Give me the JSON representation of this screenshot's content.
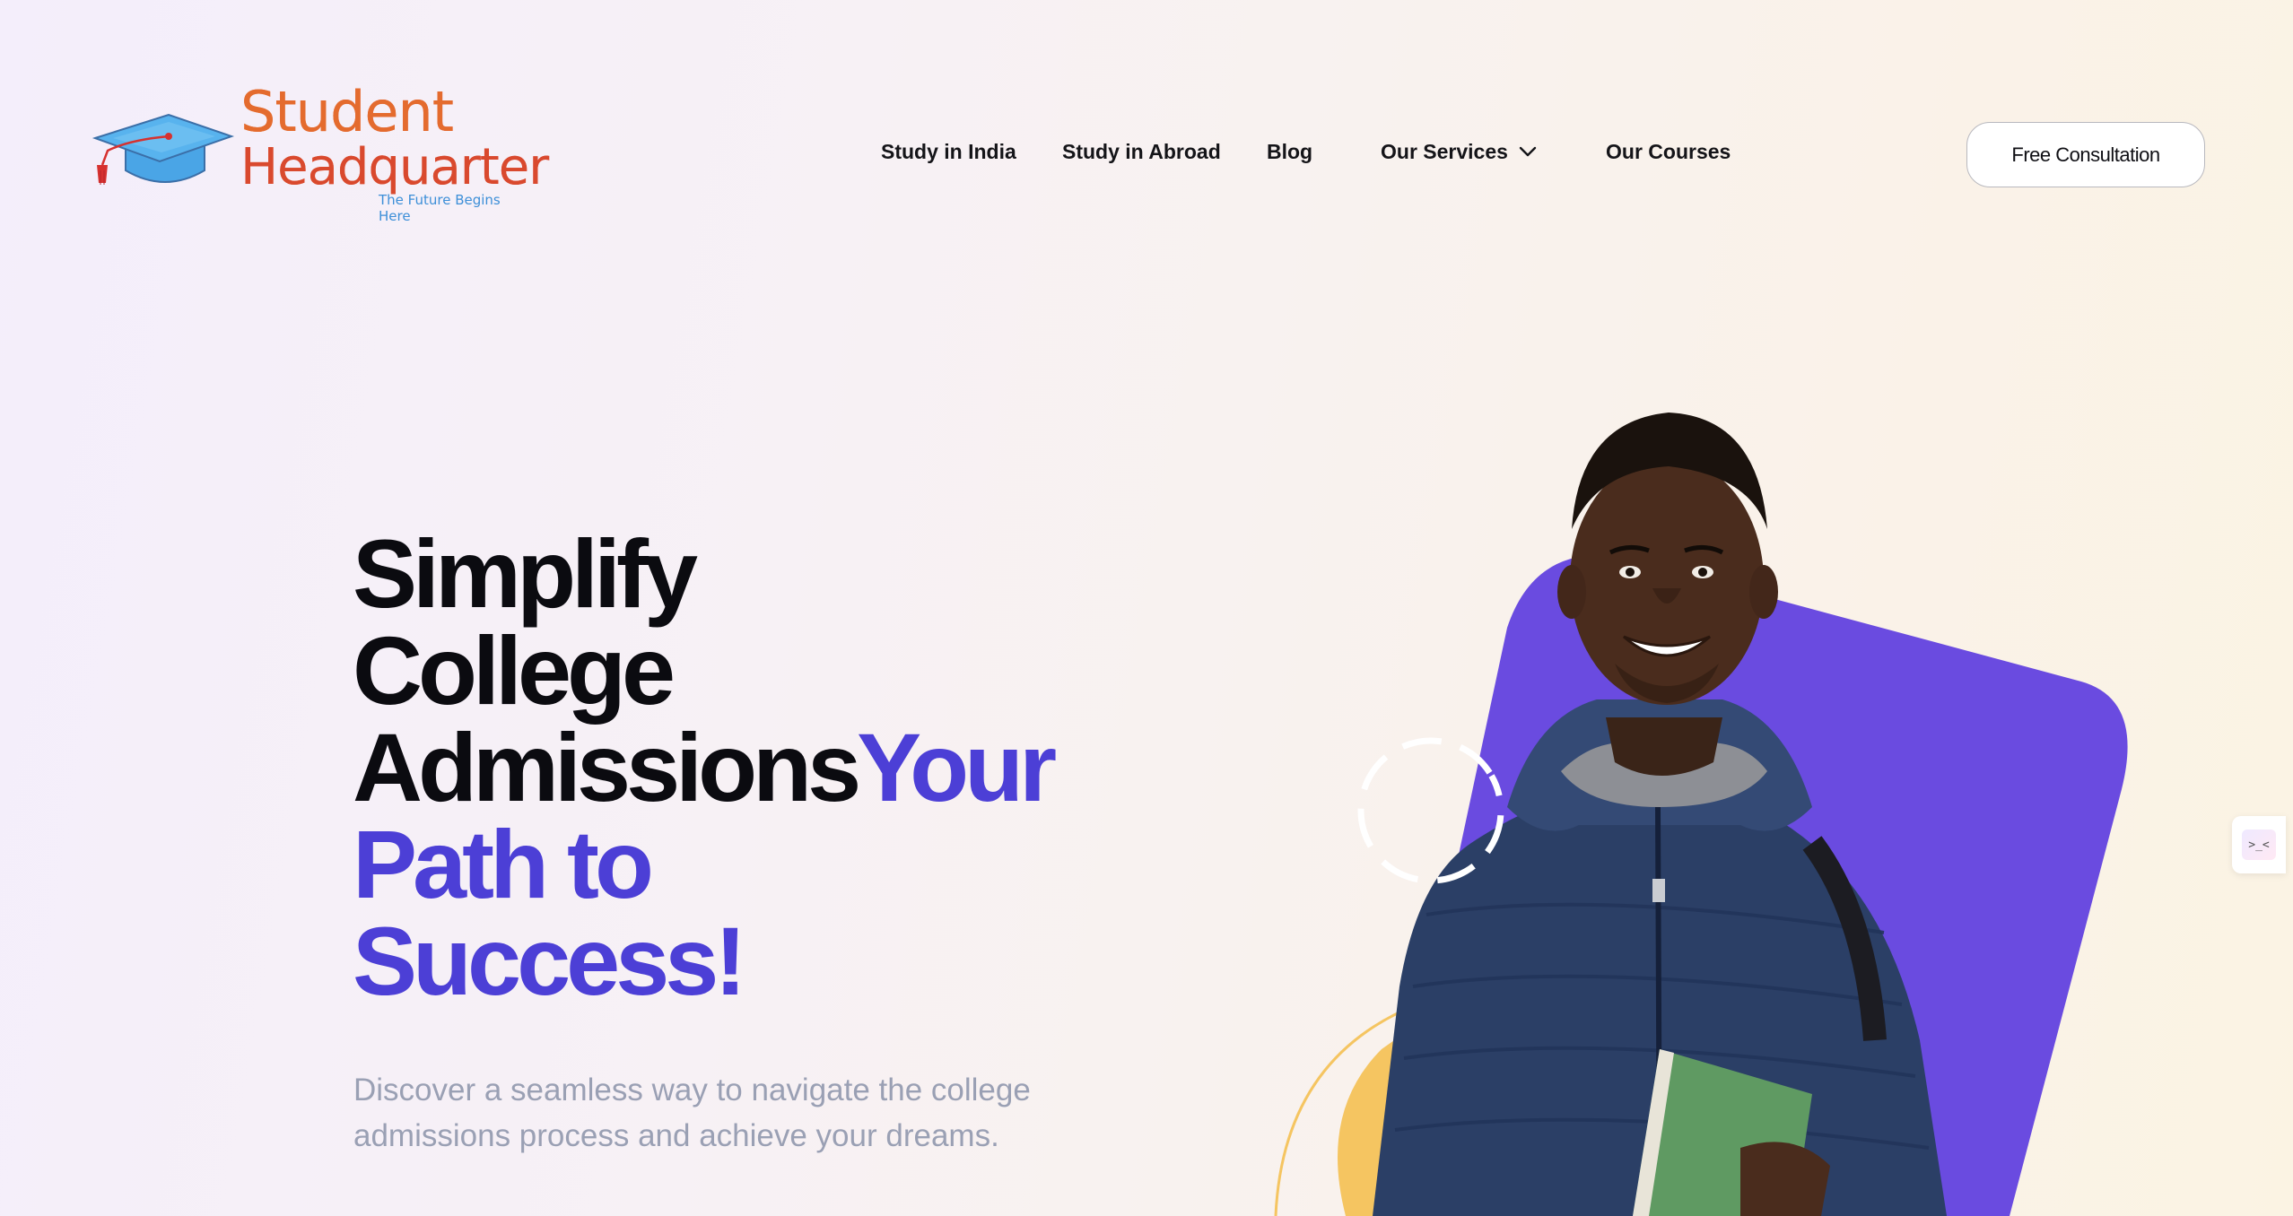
{
  "brand": {
    "name_line1": "Student",
    "name_line2": "Headquarter",
    "tagline": "The Future Begins Here",
    "colors": {
      "wordmark_orange": "#e46b2e",
      "wordmark_red": "#d9492e",
      "tagline_blue": "#3d8fd8",
      "cap_blue": "#4aa5e6",
      "tassel_red": "#d6312f"
    },
    "icon": "graduation-cap-icon"
  },
  "nav": {
    "items": [
      {
        "label": "Study in India"
      },
      {
        "label": "Study in Abroad"
      },
      {
        "label": "Blog"
      },
      {
        "label": "Our Services",
        "icon": "chevron-down-icon"
      },
      {
        "label": "Our Courses"
      }
    ]
  },
  "cta": {
    "label": "Free Consultation"
  },
  "hero": {
    "title_lines": [
      "Simplify",
      "College",
      "Admissions"
    ],
    "title_accent_inline": "Your",
    "title_accent_lines": [
      "Path to",
      "Success!"
    ],
    "subtitle_line1": "Discover a seamless way to navigate the college",
    "subtitle_line2": "admissions process and achieve your dreams.",
    "colors": {
      "title": "#0b0b10",
      "accent": "#4c3fd6",
      "subtitle": "#9aa0b4",
      "purple_shape": "#6a4be0",
      "yellow_blob": "#f5c561"
    }
  },
  "side_widget": {
    "glyph": ">_<"
  }
}
